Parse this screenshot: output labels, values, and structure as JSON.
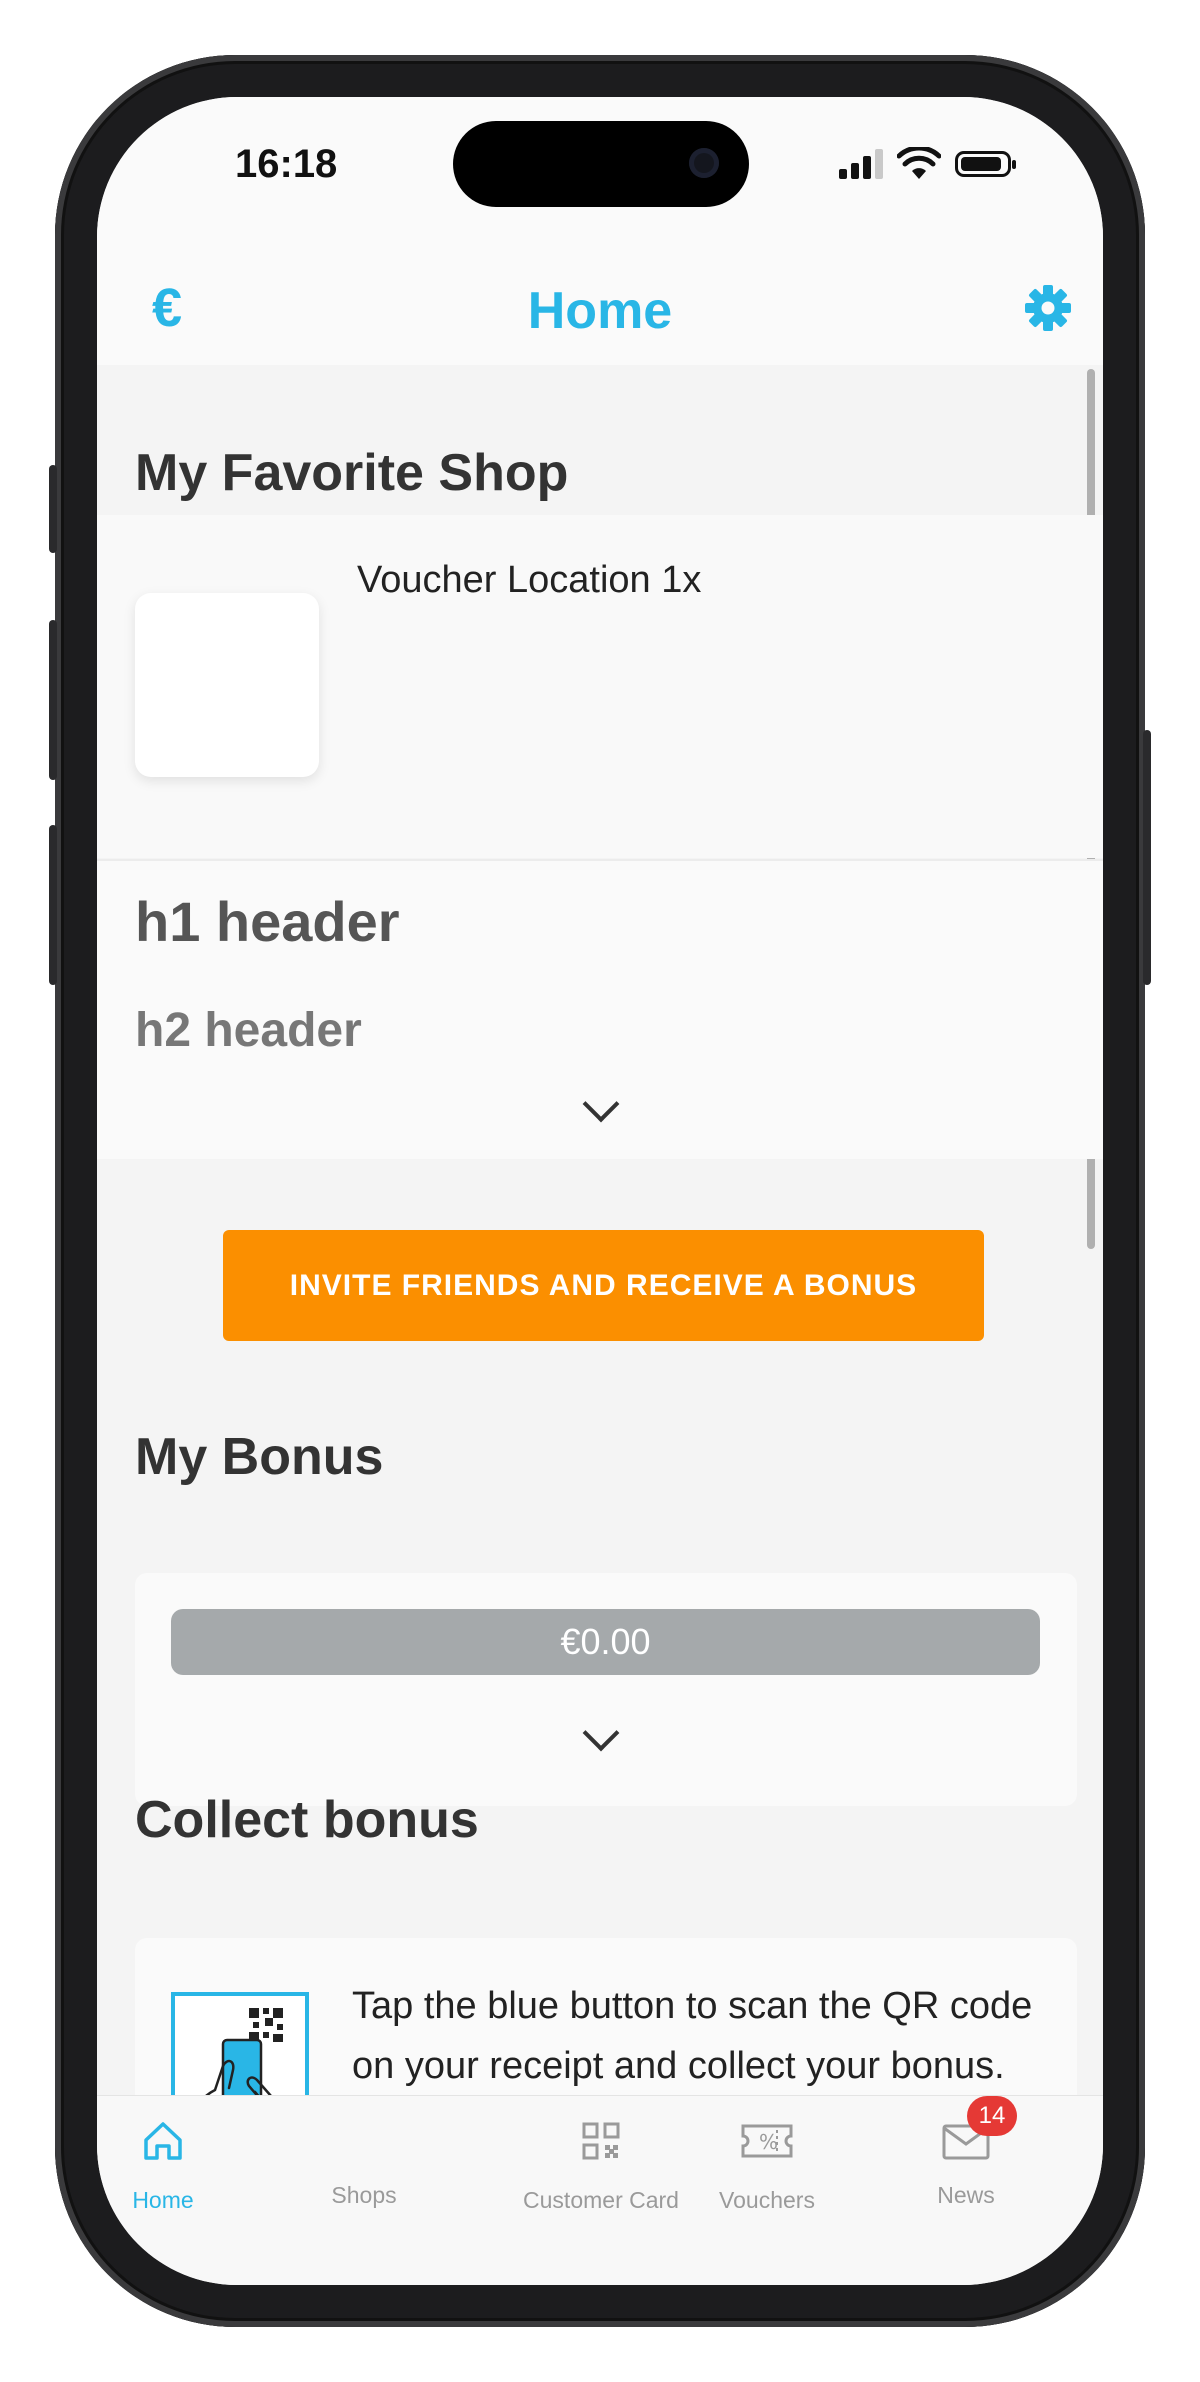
{
  "status_bar": {
    "time": "16:18"
  },
  "nav": {
    "title": "Home",
    "currency_symbol": "€"
  },
  "favorite_shop": {
    "section_title": "My Favorite Shop",
    "shop_name": "Voucher Location 1x"
  },
  "content_block": {
    "h1": "h1 header",
    "h2": "h2 header"
  },
  "invite": {
    "label": "INVITE FRIENDS AND RECEIVE A BONUS"
  },
  "bonus": {
    "section_title": "My Bonus",
    "amount": "€0.00"
  },
  "collect": {
    "section_title": "Collect bonus",
    "instructions": "Tap the blue button to scan the QR code on your receipt and collect your bonus."
  },
  "tabs": [
    {
      "label": "Home",
      "icon": "home-icon",
      "active": true
    },
    {
      "label": "Shops",
      "icon": "shops-icon"
    },
    {
      "label": "Customer Card",
      "icon": "qr-code-icon"
    },
    {
      "label": "Vouchers",
      "icon": "voucher-icon"
    },
    {
      "label": "News",
      "icon": "mail-icon",
      "badge": "14"
    }
  ],
  "colors": {
    "accent": "#29b6e6",
    "invite_button": "#fb8f00",
    "bonus_pill": "#a5a9ab",
    "badge": "#e53935"
  }
}
